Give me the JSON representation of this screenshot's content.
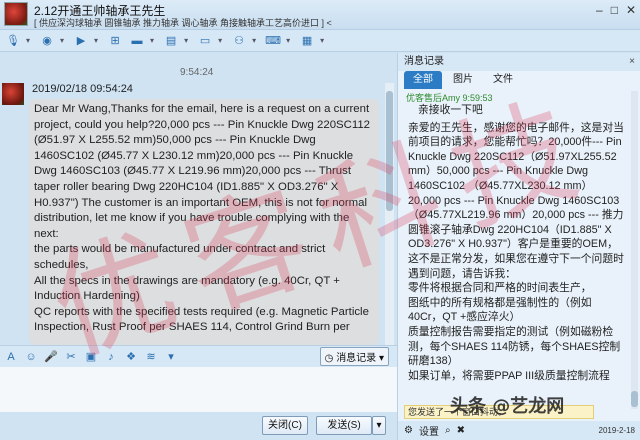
{
  "window": {
    "title": "2.12开通王帅轴承王先生",
    "subtitle": "[ 供应深沟球轴承 圆锥轴承 推力轴承 调心轴承 角接触轴承工艺高价进口 ] <"
  },
  "chat": {
    "time_separator": "9:54:24",
    "sender_line": "2019/02/18 09:54:24",
    "message_paragraphs": [
      "Dear Mr Wang,Thanks for the email, here is a request on a current project, could you help?20,000 pcs --- Pin Knuckle Dwg 220SC112 (Ø51.97 X L255.52 mm)50,000 pcs --- Pin Knuckle Dwg 1460SC102 (Ø45.77 X L230.12 mm)20,000 pcs --- Pin Knuckle Dwg 1460SC103 (Ø45.77 X L219.96 mm)20,000 pcs --- Thrust taper roller bearing Dwg 220HC104 (ID1.885\" X OD3.276\" X H0.937\") The customer is an important OEM, this is not for normal distribution, let me know if you have trouble complying with the next:",
      "the parts would be manufactured under contract and strict schedules,",
      "All the specs in the drawings are mandatory (e.g. 40Cr, QT + Induction Hardening)",
      "QC reports with the specified tests required (e.g. Magnetic Particle Inspection, Rust Proof per SHAES 114, Control Grind Burn per"
    ]
  },
  "input_toolbar": {
    "record_button": "消息记录"
  },
  "buttons": {
    "close": "关闭(C)",
    "send": "发送(S)"
  },
  "side_panel": {
    "header": "消息记录",
    "close": "×",
    "tabs": [
      "全部",
      "图片",
      "文件"
    ],
    "record_meta": "优客售后Amy 9:59:53",
    "first_line": "亲接收一下吧",
    "paragraphs": [
      "亲爱的王先生，感谢您的电子邮件，这是对当前项目的请求，您能帮忙吗？20,000件--- Pin Knuckle Dwg 220SC112（Ø51.97XL255.52 mm）50,000 pcs --- Pin Knuckle Dwg 1460SC102 （Ø45.77XL230.12 mm）20,000 pcs --- Pin Knuckle Dwg 1460SC103（Ø45.77XL219.96 mm）20,000 pcs --- 推力圆锥滚子轴承Dwg 220HC104（ID1.885\" X OD3.276\" X H0.937\"）客户是重要的OEM，这不是正常分发，如果您在遵守下一个问题时遇到问题，请告诉我：",
      "零件将根据合同和严格的时间表生产，",
      "图纸中的所有规格都是强制性的（例如40Cr，QT +感应淬火）",
      "质量控制报告需要指定的测试（例如磁粉检测，每个SHAES 114防锈，每个SHAES控制研磨138）",
      "如果订单，将需要PPAP III级质量控制流程"
    ],
    "notice": "您发送了一个窗口抖动。",
    "footer_settings": "设置",
    "footer_date": "2019-2-18"
  },
  "overlay": {
    "watermark": "优客科技",
    "logo": "头条 @艺龙网"
  },
  "icons": [
    "mic-icon",
    "camera-icon",
    "video-icon",
    "screen-share-icon",
    "folder-icon",
    "app-icon",
    "monitor-icon",
    "group-icon",
    "keyboard-icon",
    "more-icon"
  ]
}
